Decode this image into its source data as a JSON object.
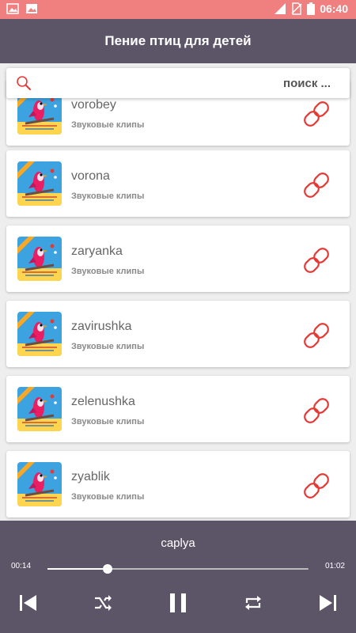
{
  "status_bar": {
    "time": "06:40",
    "icons": [
      "image-icon",
      "image-icon",
      "signal-icon",
      "no-sim-icon",
      "battery-icon"
    ]
  },
  "app_bar": {
    "title": "Пение птиц для детей"
  },
  "search": {
    "placeholder": "поиск ..."
  },
  "list": {
    "items": [
      {
        "title": "vorobey",
        "subtitle": "Звуковые клипы",
        "icon": "link-icon"
      },
      {
        "title": "vorona",
        "subtitle": "Звуковые клипы",
        "icon": "link-icon"
      },
      {
        "title": "zaryanka",
        "subtitle": "Звуковые клипы",
        "icon": "link-icon"
      },
      {
        "title": "zavirushka",
        "subtitle": "Звуковые клипы",
        "icon": "link-icon"
      },
      {
        "title": "zelenushka",
        "subtitle": "Звуковые клипы",
        "icon": "link-icon"
      },
      {
        "title": "zyablik",
        "subtitle": "Звуковые клипы",
        "icon": "link-icon"
      }
    ]
  },
  "player": {
    "track_title": "caplya",
    "current_time": "00:14",
    "total_time": "01:02",
    "progress": 0.23,
    "controls": [
      "skip-previous-icon",
      "shuffle-icon",
      "pause-icon",
      "repeat-icon",
      "skip-next-icon"
    ]
  },
  "colors": {
    "status_bar": "#f08080",
    "app_bar": "#5c5568",
    "accent": "#e53935",
    "card_background": "#ffffff"
  }
}
